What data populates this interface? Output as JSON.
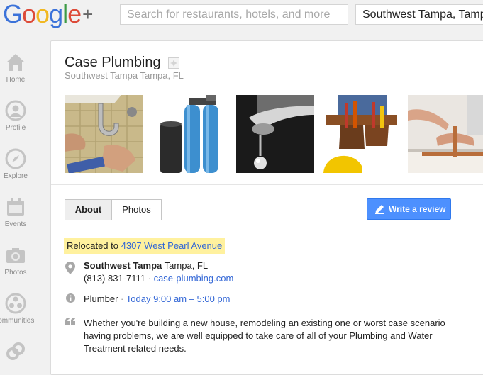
{
  "header": {
    "logo_letters": [
      "G",
      "o",
      "o",
      "g",
      "l",
      "e"
    ],
    "logo_plus": "+",
    "search_placeholder": "Search for restaurants, hotels, and more",
    "location_value": "Southwest Tampa, Tampa, FL"
  },
  "nav": {
    "items": [
      {
        "label": "Home",
        "icon": "home-icon"
      },
      {
        "label": "Profile",
        "icon": "profile-icon"
      },
      {
        "label": "Explore",
        "icon": "compass-icon"
      },
      {
        "label": "Events",
        "icon": "calendar-icon"
      },
      {
        "label": "Photos",
        "icon": "camera-icon"
      },
      {
        "label": "Communities",
        "icon": "communities-icon"
      },
      {
        "label": "",
        "icon": "more-icon"
      }
    ]
  },
  "business": {
    "name": "Case Plumbing",
    "location": "Southwest Tampa Tampa, FL",
    "photos": [
      {
        "icon": "photo-pipe-repair"
      },
      {
        "icon": "photo-water-softener-tanks"
      },
      {
        "icon": "photo-dripping-faucet"
      },
      {
        "icon": "photo-tool-belt"
      },
      {
        "icon": "photo-copper-pipe-soldering"
      }
    ],
    "tabs": {
      "about": "About",
      "photos": "Photos"
    },
    "write_review": "Write a review",
    "relocated": {
      "prefix": "Relocated to",
      "address": "4307 West Pearl Avenue"
    },
    "address": {
      "neighborhood": "Southwest Tampa",
      "city": "Tampa, FL"
    },
    "phone": "(813) 831-7111",
    "separator": "·",
    "website": "case-plumbing.com",
    "category": "Plumber",
    "hours": "Today 9:00 am – 5:00 pm",
    "description": "Whether you're building a new house, remodeling an existing one or worst case scenario having problems, we are well equipped to take care of all of your Plumbing and Water Treatment related needs."
  },
  "colors": {
    "accent_blue": "#4d90fe",
    "link_blue": "#3367d6",
    "highlight_yellow": "#fff19e",
    "nav_gray": "#8a8a8a"
  }
}
